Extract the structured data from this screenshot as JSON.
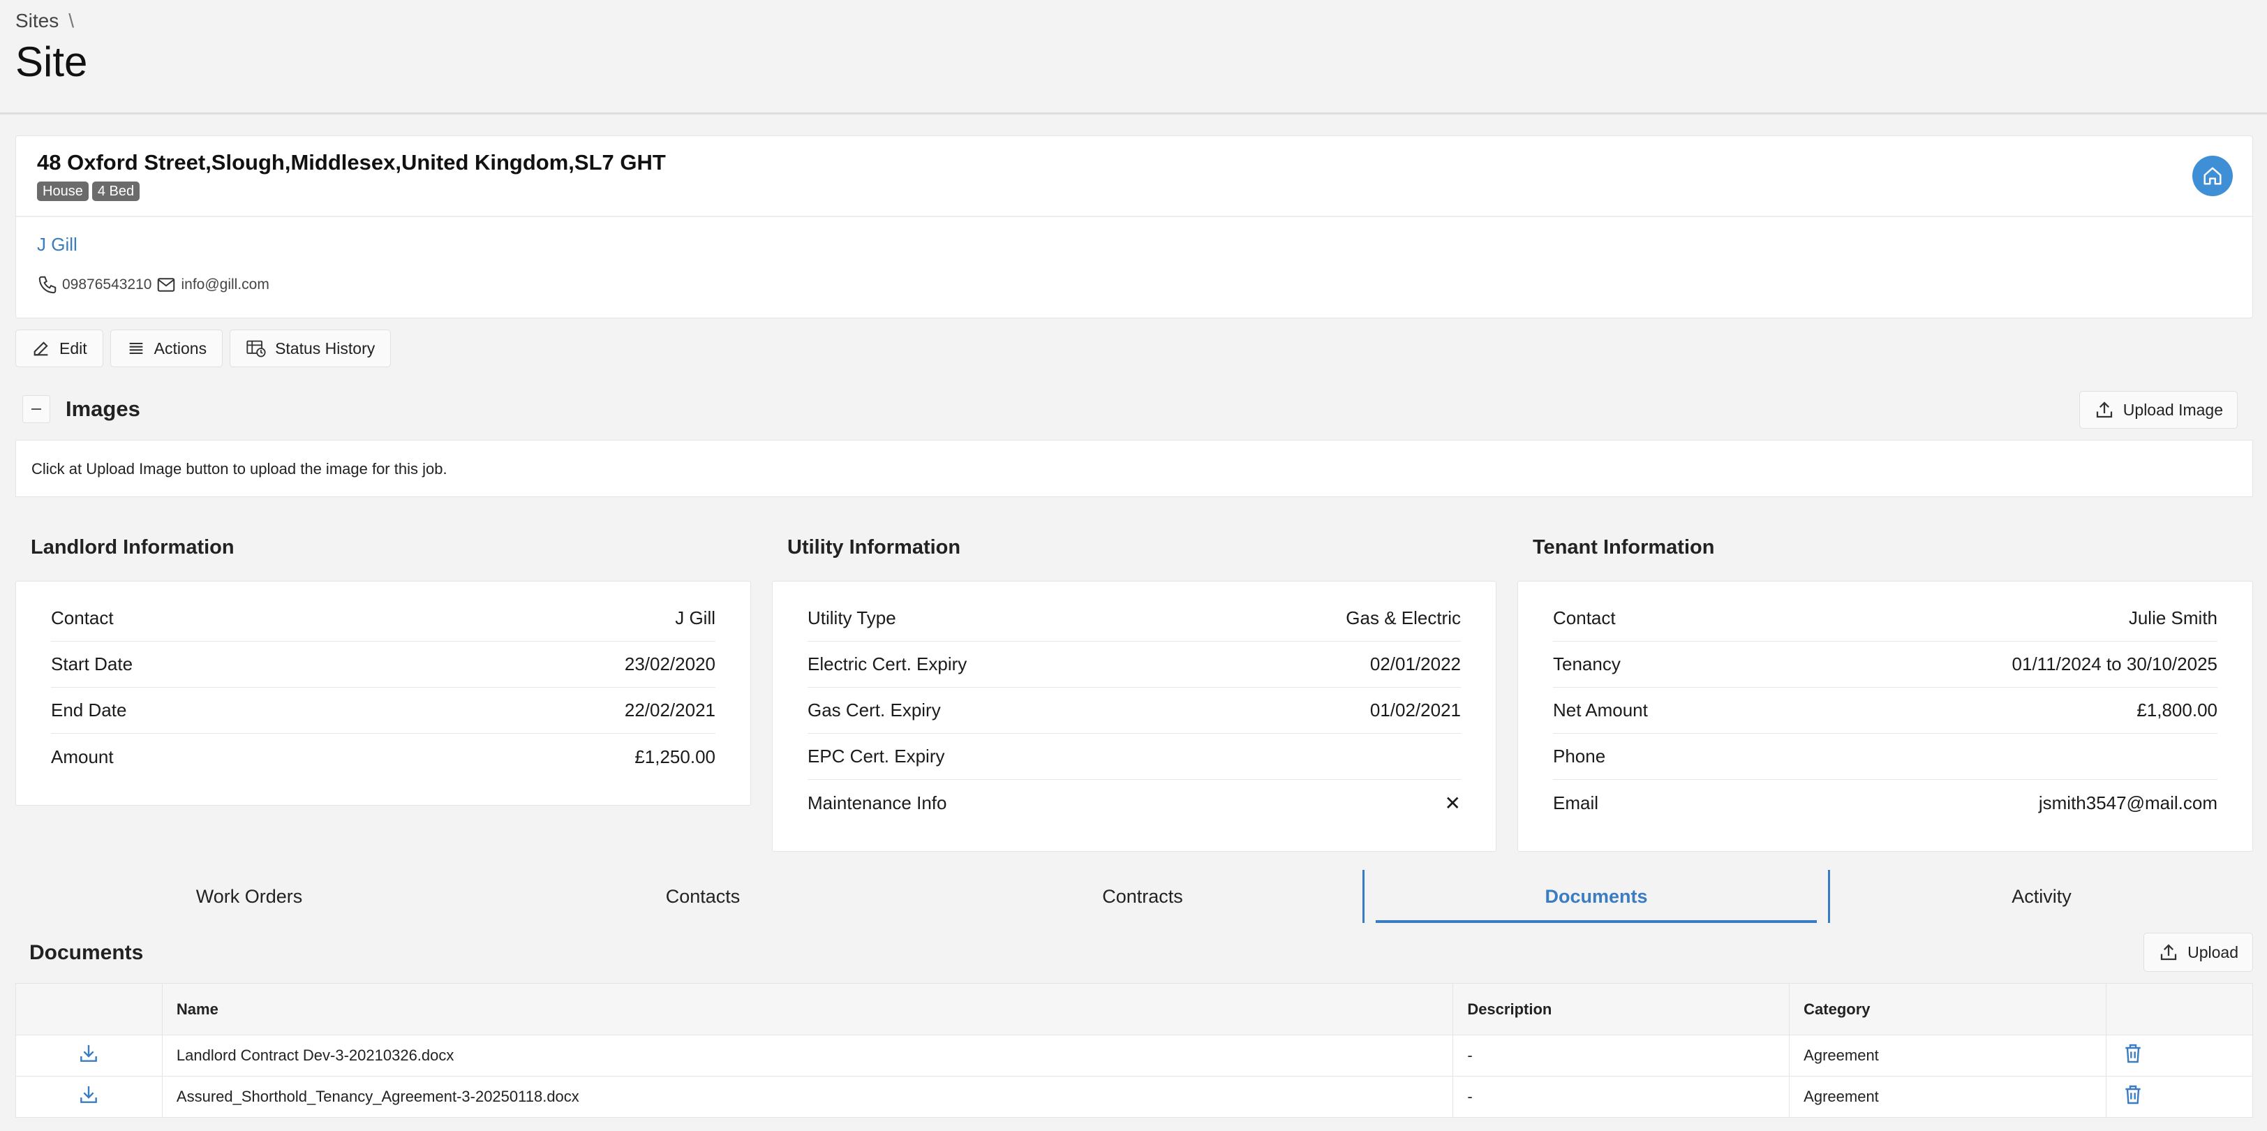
{
  "breadcrumb": {
    "root": "Sites",
    "separator": "\\"
  },
  "page_title": "Site",
  "site": {
    "address": "48 Oxford Street,Slough,Middlesex,United Kingdom,SL7 GHT",
    "badges": [
      "House",
      "4 Bed"
    ],
    "contact_name": "J Gill",
    "phone": "09876543210",
    "email": "info@gill.com"
  },
  "toolbar": {
    "edit_label": "Edit",
    "actions_label": "Actions",
    "status_history_label": "Status History"
  },
  "images": {
    "title": "Images",
    "upload_label": "Upload Image",
    "message": "Click at Upload Image button to upload the image for this job."
  },
  "landlord": {
    "title": "Landlord Information",
    "rows": [
      {
        "label": "Contact",
        "value": "J Gill"
      },
      {
        "label": "Start Date",
        "value": "23/02/2020"
      },
      {
        "label": "End Date",
        "value": "22/02/2021"
      },
      {
        "label": "Amount",
        "value": "£1,250.00"
      }
    ]
  },
  "utility": {
    "title": "Utility Information",
    "rows": [
      {
        "label": "Utility Type",
        "value": "Gas & Electric"
      },
      {
        "label": "Electric Cert. Expiry",
        "value": "02/01/2022"
      },
      {
        "label": "Gas Cert. Expiry",
        "value": "01/02/2021"
      },
      {
        "label": "EPC Cert. Expiry",
        "value": ""
      },
      {
        "label": "Maintenance Info",
        "value": "✕"
      }
    ]
  },
  "tenant": {
    "title": "Tenant Information",
    "rows": [
      {
        "label": "Contact",
        "value": "Julie Smith"
      },
      {
        "label": "Tenancy",
        "value": "01/11/2024 to 30/10/2025"
      },
      {
        "label": "Net Amount",
        "value": "£1,800.00"
      },
      {
        "label": "Phone",
        "value": ""
      },
      {
        "label": "Email",
        "value": "jsmith3547@mail.com"
      }
    ]
  },
  "tabs": [
    {
      "label": "Work Orders",
      "active": false
    },
    {
      "label": "Contacts",
      "active": false
    },
    {
      "label": "Contracts",
      "active": false
    },
    {
      "label": "Documents",
      "active": true
    },
    {
      "label": "Activity",
      "active": false
    }
  ],
  "documents": {
    "title": "Documents",
    "upload_label": "Upload",
    "columns": [
      "",
      "Name",
      "Description",
      "Category",
      ""
    ],
    "rows": [
      {
        "name": "Landlord Contract Dev-3-20210326.docx",
        "description": "-",
        "category": "Agreement"
      },
      {
        "name": "Assured_Shorthold_Tenancy_Agreement-3-20250118.docx",
        "description": "-",
        "category": "Agreement"
      }
    ]
  },
  "colors": {
    "accent": "#3a7cc2",
    "home_button": "#3e8fd6",
    "badge": "#6b6b6b",
    "background": "#f3f3f3"
  },
  "icons": [
    "home-icon",
    "phone-icon",
    "mail-icon",
    "edit-icon",
    "list-icon",
    "status-history-icon",
    "upload-icon",
    "download-icon",
    "trash-icon",
    "close-icon"
  ]
}
